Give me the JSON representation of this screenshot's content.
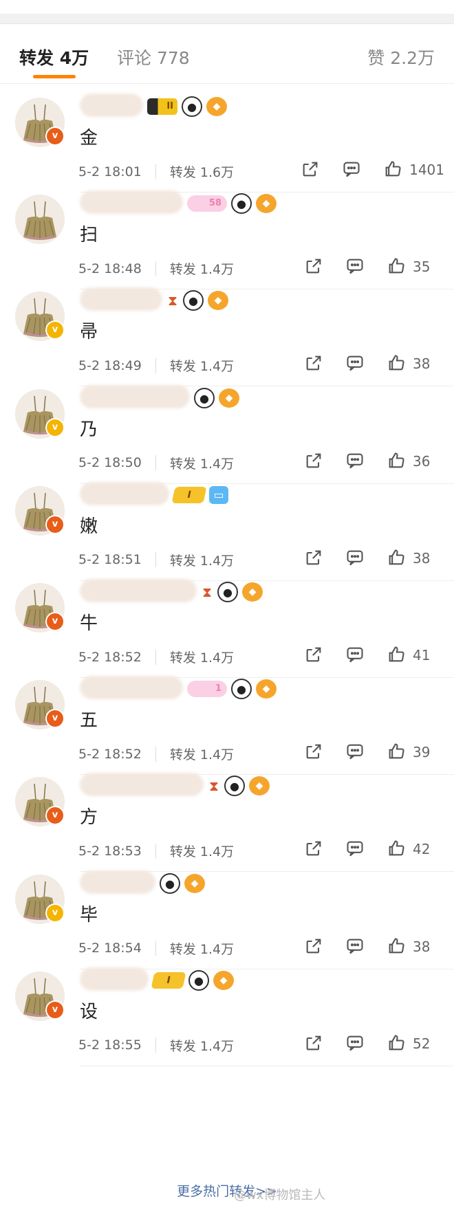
{
  "tabs": {
    "reposts": "转发 4万",
    "comments": "评论 778",
    "likes": "赞 2.2万"
  },
  "colors": {
    "accent": "#ff8200",
    "badge_red": "#e85d19",
    "badge_gold": "#f4b400"
  },
  "items": [
    {
      "comment": "金",
      "time": "5-2 18:01",
      "reposts": "转发 1.6万",
      "likes": "1401",
      "badge_color": "red"
    },
    {
      "comment": "扫",
      "time": "5-2 18:48",
      "reposts": "转发 1.4万",
      "likes": "35",
      "badge_color": "none"
    },
    {
      "comment": "帚",
      "time": "5-2 18:49",
      "reposts": "转发 1.4万",
      "likes": "38",
      "badge_color": "gold"
    },
    {
      "comment": "乃",
      "time": "5-2 18:50",
      "reposts": "转发 1.4万",
      "likes": "36",
      "badge_color": "gold"
    },
    {
      "comment": "嫩",
      "time": "5-2 18:51",
      "reposts": "转发 1.4万",
      "likes": "38",
      "badge_color": "red"
    },
    {
      "comment": "牛",
      "time": "5-2 18:52",
      "reposts": "转发 1.4万",
      "likes": "41",
      "badge_color": "red"
    },
    {
      "comment": "五",
      "time": "5-2 18:52",
      "reposts": "转发 1.4万",
      "likes": "39",
      "badge_color": "red"
    },
    {
      "comment": "方",
      "time": "5-2 18:53",
      "reposts": "转发 1.4万",
      "likes": "42",
      "badge_color": "red"
    },
    {
      "comment": "毕",
      "time": "5-2 18:54",
      "reposts": "转发 1.4万",
      "likes": "38",
      "badge_color": "gold"
    },
    {
      "comment": "设",
      "time": "5-2 18:55",
      "reposts": "转发 1.4万",
      "likes": "52",
      "badge_color": "red"
    }
  ],
  "footer": {
    "more_link": "更多热门转发>>",
    "watermark": "@wx博物馆主人"
  },
  "icons": {
    "share": "share-icon",
    "comment": "comment-icon",
    "like": "like-icon"
  }
}
